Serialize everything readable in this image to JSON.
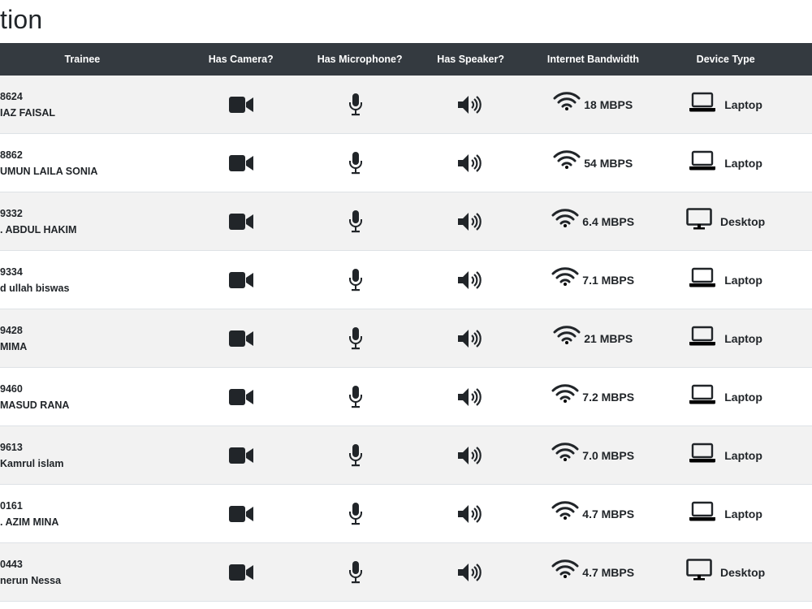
{
  "page": {
    "title": "tion"
  },
  "table": {
    "headers": {
      "trainee": "Trainee",
      "camera": "Has Camera?",
      "microphone": "Has Microphone?",
      "speaker": "Has Speaker?",
      "bandwidth": "Internet Bandwidth",
      "device": "Device Type"
    },
    "rows": [
      {
        "id": "8624",
        "name": "IAZ FAISAL",
        "bandwidth": "18 MBPS",
        "device": "Laptop",
        "device_icon": "laptop-icon"
      },
      {
        "id": "8862",
        "name": "UMUN LAILA SONIA",
        "bandwidth": "54 MBPS",
        "device": "Laptop",
        "device_icon": "laptop-icon"
      },
      {
        "id": "9332",
        "name": ". ABDUL HAKIM",
        "bandwidth": "6.4 MBPS",
        "device": "Desktop",
        "device_icon": "desktop-icon"
      },
      {
        "id": "9334",
        "name": "d ullah biswas",
        "bandwidth": "7.1 MBPS",
        "device": "Laptop",
        "device_icon": "laptop-icon"
      },
      {
        "id": "9428",
        "name": "MIMA",
        "bandwidth": "21 MBPS",
        "device": "Laptop",
        "device_icon": "laptop-icon"
      },
      {
        "id": "9460",
        "name": "MASUD RANA",
        "bandwidth": "7.2 MBPS",
        "device": "Laptop",
        "device_icon": "laptop-icon"
      },
      {
        "id": "9613",
        "name": " Kamrul islam",
        "bandwidth": "7.0 MBPS",
        "device": "Laptop",
        "device_icon": "laptop-icon"
      },
      {
        "id": "0161",
        "name": ". AZIM MINA",
        "bandwidth": "4.7 MBPS",
        "device": "Laptop",
        "device_icon": "laptop-icon"
      },
      {
        "id": "0443",
        "name": "nerun Nessa",
        "bandwidth": "4.7 MBPS",
        "device": "Desktop",
        "device_icon": "desktop-icon"
      }
    ]
  },
  "icons": {
    "camera": "video-camera-icon",
    "microphone": "microphone-icon",
    "speaker": "speaker-icon",
    "bandwidth": "wifi-icon"
  },
  "colors": {
    "header_bg": "#343a40",
    "stripe_bg": "#f2f2f2",
    "text": "#212529"
  }
}
